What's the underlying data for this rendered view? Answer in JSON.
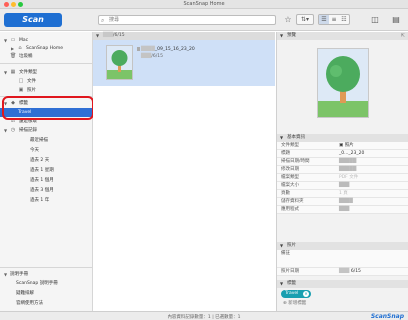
{
  "window": {
    "title": "ScanSnap Home",
    "traffic": [
      "#ff5f57",
      "#febc2e",
      "#28c840"
    ]
  },
  "toolbar": {
    "scan_label": "Scan",
    "search_placeholder": "搜尋",
    "icons": [
      "star-icon",
      "sort-icon",
      "view-list-icon",
      "view-detail-icon",
      "view-grid-icon",
      "inspector-icon",
      "panel-icon"
    ]
  },
  "sidebar": {
    "items": [
      {
        "id": "mac",
        "label": "Mac",
        "icon": "computer-icon",
        "expanded": true
      },
      {
        "id": "scansnap-home",
        "label": "ScanSnap Home",
        "icon": "home-icon"
      },
      {
        "id": "trash",
        "label": "垃圾桶",
        "icon": "trash-icon"
      },
      {
        "id": "doc-type",
        "label": "文件類型",
        "icon": "folder-icon",
        "expanded": true
      },
      {
        "id": "docs",
        "label": "文件",
        "icon": "document-icon"
      },
      {
        "id": "photos",
        "label": "照片",
        "icon": "photo-icon"
      },
      {
        "id": "tags",
        "label": "標籤",
        "icon": "tag-icon",
        "expanded": true
      },
      {
        "id": "travel",
        "label": "Travel",
        "icon": "",
        "selected": true
      },
      {
        "id": "unchecked",
        "label": "還是核取",
        "icon": "check-icon"
      },
      {
        "id": "scan-history",
        "label": "掃描記錄",
        "icon": "clock-icon",
        "expanded": true
      },
      {
        "id": "recent",
        "label": "最近掃描",
        "icon": ""
      },
      {
        "id": "today",
        "label": "今天",
        "icon": ""
      },
      {
        "id": "last2days",
        "label": "過去 2 天",
        "icon": ""
      },
      {
        "id": "last1week",
        "label": "過去 1 星期",
        "icon": ""
      },
      {
        "id": "last1month",
        "label": "過去 1 個月",
        "icon": ""
      },
      {
        "id": "last3months",
        "label": "過去 3 個月",
        "icon": ""
      },
      {
        "id": "last1year",
        "label": "過去 1 年",
        "icon": ""
      }
    ],
    "footer": {
      "header": "說明手冊",
      "links": [
        "ScanSnap 說明手冊",
        "疑難排解",
        "官網使用方法"
      ]
    }
  },
  "main": {
    "group_header": "/6/15",
    "file": {
      "name": "_09_15_16_23_20",
      "date": "/6/15"
    }
  },
  "inspector": {
    "preview_header": "預覽",
    "basic_header": "基本資訊",
    "basic_rows": [
      {
        "key": "文件類型",
        "value": "照片",
        "muted": false
      },
      {
        "key": "標題",
        "value": "_0..._23_20",
        "muted": false
      },
      {
        "key": "掃描日期/時間",
        "value": "",
        "muted": true
      },
      {
        "key": "修改日期",
        "value": "",
        "muted": true
      },
      {
        "key": "檔案類型",
        "value": "PDF 文件",
        "muted": true
      },
      {
        "key": "檔案大小",
        "value": "",
        "muted": true
      },
      {
        "key": "頁數",
        "value": "1 頁",
        "muted": true
      },
      {
        "key": "儲存資料夾",
        "value": "",
        "muted": true
      },
      {
        "key": "應用程式",
        "value": "",
        "muted": true
      }
    ],
    "photo_header": "照片",
    "photo_rows": [
      {
        "key": "備註",
        "value": ""
      },
      {
        "key": "照片日期",
        "value": "6/15"
      }
    ],
    "tags_header": "標籤",
    "tag": "Travel",
    "add_tag": "新增標籤"
  },
  "status": {
    "text": "內容資料記錄數量：1 | 已選數量：1",
    "brand": "ScanSnap"
  }
}
